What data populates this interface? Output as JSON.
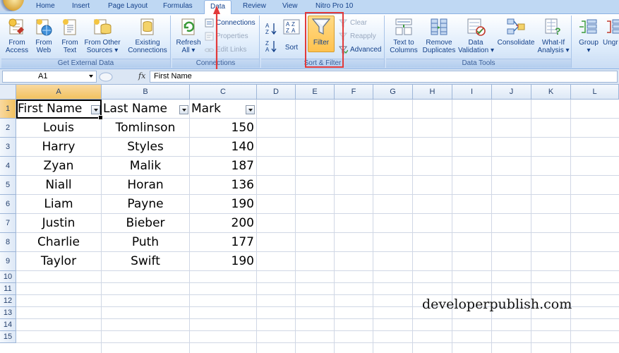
{
  "tabs": [
    "Home",
    "Insert",
    "Page Layout",
    "Formulas",
    "Data",
    "Review",
    "View",
    "Nitro Pro 10"
  ],
  "active_tab": "Data",
  "ribbon": {
    "get_external_data": {
      "label": "Get External Data",
      "from_access": [
        "From",
        "Access"
      ],
      "from_web": [
        "From",
        "Web"
      ],
      "from_text": [
        "From",
        "Text"
      ],
      "from_other_sources": [
        "From Other",
        "Sources ▾"
      ],
      "existing_connections": [
        "Existing",
        "Connections"
      ]
    },
    "connections": {
      "label": "Connections",
      "refresh_all": [
        "Refresh",
        "All ▾"
      ],
      "connections": "Connections",
      "properties": "Properties",
      "edit_links": "Edit Links"
    },
    "sort_filter": {
      "label": "Sort & Filter",
      "sort": "Sort",
      "filter": "Filter",
      "clear": "Clear",
      "reapply": "Reapply",
      "advanced": "Advanced"
    },
    "data_tools": {
      "label": "Data Tools",
      "text_to_columns": [
        "Text to",
        "Columns"
      ],
      "remove_duplicates": [
        "Remove",
        "Duplicates"
      ],
      "data_validation": [
        "Data",
        "Validation ▾"
      ],
      "consolidate": "Consolidate",
      "what_if": [
        "What-If",
        "Analysis ▾"
      ]
    },
    "outline": {
      "group": [
        "Group",
        "▾"
      ],
      "ungroup": "Ungr"
    }
  },
  "formula_bar": {
    "name_box": "A1",
    "fx": "fx",
    "content": "First Name"
  },
  "columns": [
    "A",
    "B",
    "C",
    "D",
    "E",
    "F",
    "G",
    "H",
    "I",
    "J",
    "K",
    "L"
  ],
  "rows": [
    "1",
    "2",
    "3",
    "4",
    "5",
    "6",
    "7",
    "8",
    "9",
    "10",
    "11",
    "12",
    "13",
    "14",
    "15"
  ],
  "table": {
    "headers": [
      "First Name",
      "Last Name",
      "Mark"
    ],
    "data": [
      [
        "Louis",
        "Tomlinson",
        "150"
      ],
      [
        "Harry",
        "Styles",
        "140"
      ],
      [
        "Zyan",
        "Malik",
        "187"
      ],
      [
        "Niall",
        "Horan",
        "136"
      ],
      [
        "Liam",
        "Payne",
        "190"
      ],
      [
        "Justin",
        "Bieber",
        "200"
      ],
      [
        "Charlie",
        "Puth",
        "177"
      ],
      [
        "Taylor",
        "Swift",
        "190"
      ]
    ]
  },
  "watermark": "developerpublish.com",
  "colors": {
    "accent_red": "#e23a3a",
    "filter_highlight": "#ffc24f",
    "ribbon_text": "#15428b"
  }
}
